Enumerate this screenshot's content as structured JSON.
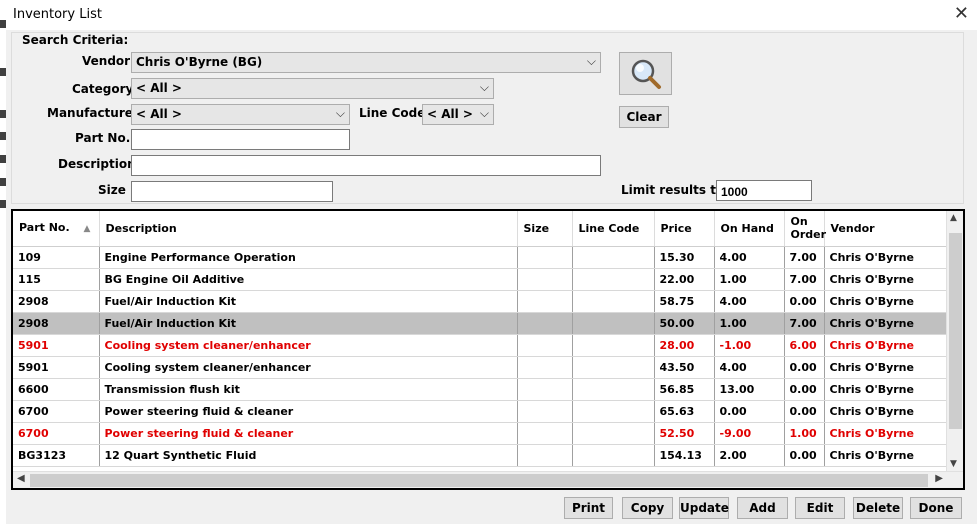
{
  "window": {
    "title": "Inventory List",
    "close_glyph": "✕"
  },
  "search": {
    "legend": "Search Criteria:",
    "vendor_label": "Vendor",
    "vendor_value": "Chris O'Byrne (BG)",
    "category_label": "Category",
    "category_value": "< All >",
    "manufacturer_label": "Manufacturer",
    "manufacturer_value": "< All >",
    "linecode_label": "Line Code",
    "linecode_value": "< All >",
    "partno_label": "Part No.",
    "partno_value": "",
    "description_label": "Description",
    "description_value": "",
    "size_label": "Size",
    "size_value": "",
    "limit_label": "Limit results to:",
    "limit_value": "1000",
    "clear_label": "Clear",
    "search_icon": "magnifier-icon"
  },
  "grid": {
    "columns": [
      "Part No.",
      "Description",
      "Size",
      "Line Code",
      "Price",
      "On Hand",
      "On Order",
      "Vendor"
    ],
    "sort_indicator": "▲",
    "rows": [
      [
        "109",
        "Engine Performance Operation",
        "",
        "",
        "15.30",
        "4.00",
        "7.00",
        "Chris O'Byrne"
      ],
      [
        "115",
        "BG Engine Oil Additive",
        "",
        "",
        "22.00",
        "1.00",
        "7.00",
        "Chris O'Byrne"
      ],
      [
        "2908",
        "Fuel/Air Induction Kit",
        "",
        "",
        "58.75",
        "4.00",
        "0.00",
        "Chris O'Byrne"
      ],
      [
        "2908",
        "Fuel/Air Induction Kit",
        "",
        "",
        "50.00",
        "1.00",
        "7.00",
        "Chris O'Byrne"
      ],
      [
        "5901",
        "Cooling system cleaner/enhancer",
        "",
        "",
        "28.00",
        "-1.00",
        "6.00",
        "Chris O'Byrne"
      ],
      [
        "5901",
        "Cooling system cleaner/enhancer",
        "",
        "",
        "43.50",
        "4.00",
        "0.00",
        "Chris O'Byrne"
      ],
      [
        "6600",
        "Transmission flush kit",
        "",
        "",
        "56.85",
        "13.00",
        "0.00",
        "Chris O'Byrne"
      ],
      [
        "6700",
        "Power steering fluid & cleaner",
        "",
        "",
        "65.63",
        "0.00",
        "0.00",
        "Chris O'Byrne"
      ],
      [
        "6700",
        "Power steering fluid & cleaner",
        "",
        "",
        "52.50",
        "-9.00",
        "1.00",
        "Chris O'Byrne"
      ],
      [
        "BG3123",
        "12 Quart Synthetic Fluid",
        "",
        "",
        "154.13",
        "2.00",
        "0.00",
        "Chris O'Byrne"
      ]
    ],
    "red_rows": [
      4,
      8
    ],
    "selected_row": 3
  },
  "buttons": {
    "print": "Print",
    "copy": "Copy",
    "update": "Update",
    "add": "Add",
    "edit": "Edit",
    "delete": "Delete",
    "done": "Done"
  },
  "colors": {
    "negative_row": "#e00000",
    "selected_row": "#c0c0c0"
  }
}
